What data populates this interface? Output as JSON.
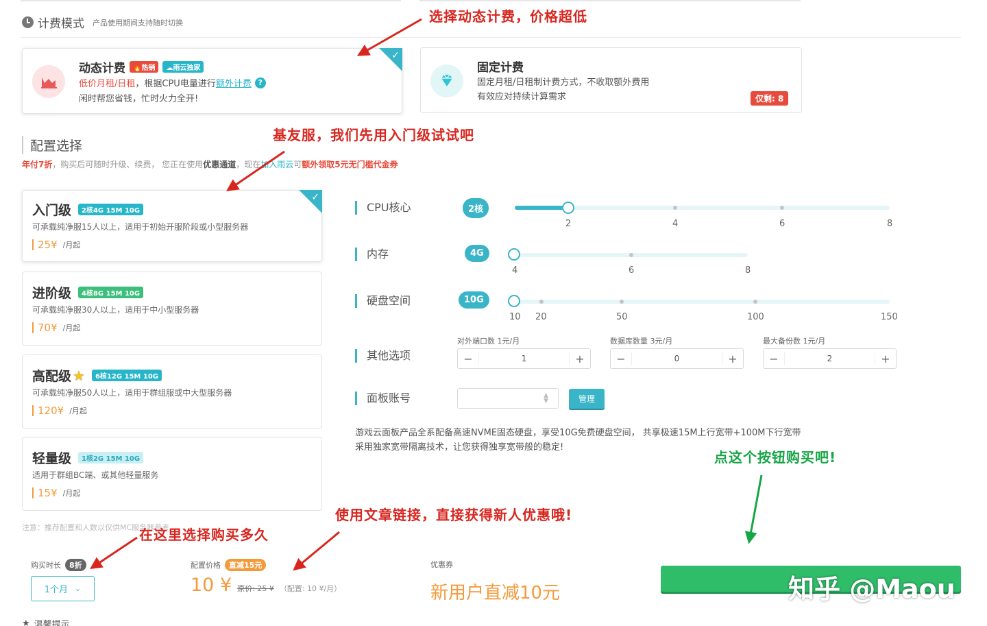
{
  "billing": {
    "section_title": "计费模式",
    "section_note": "产品使用期间支持随时切换",
    "dynamic": {
      "title": "动态计费",
      "tag_hot": "热销",
      "tag_exclusive": "雨云独家",
      "desc_line1_prefix": "低价月租/日租",
      "desc_line1_mid": "，根据CPU电量进行",
      "desc_line1_link": "额外计费",
      "desc_line2": "闲时帮您省钱，忙时火力全开!"
    },
    "fixed": {
      "title": "固定计费",
      "desc_line1": "固定月租/日租制计费方式，不收取额外费用",
      "desc_line2": "有效应对持续计算需求",
      "stock_badge": "仅剩: 8"
    }
  },
  "config": {
    "section_title": "配置选择",
    "promo_red": "年付7折",
    "promo_mid": "，购买后可随时升级、续费， 您正在使用",
    "promo_bold": "优惠通道",
    "promo_mid2": "，现在",
    "promo_link": "加入雨云",
    "promo_mid3": "可",
    "promo_red2": "额外领取5元无门槛代金券"
  },
  "plans": [
    {
      "title": "入门级",
      "spec": "2核4G 15M 10G",
      "desc": "可承载纯净服15人以上，适用于初始开服阶段或小型服务器",
      "price": "25¥",
      "unit": "/月起"
    },
    {
      "title": "进阶级",
      "spec": "4核8G 15M 10G",
      "desc": "可承载纯净服30人以上，适用于中小型服务器",
      "price": "70¥",
      "unit": "/月起"
    },
    {
      "title": "高配级",
      "spec": "6核12G 15M 10G",
      "desc": "可承载纯净服50人以上，适用于群组服或中大型服务器",
      "price": "120¥",
      "unit": "/月起"
    },
    {
      "title": "轻量级",
      "spec": "1核2G 15M 10G",
      "desc": "适用于群组BC端、或其他轻量服务",
      "price": "15¥",
      "unit": "/月起"
    }
  ],
  "plans_note": "注意：推荐配置和人数以仅供MC服务器参考",
  "sliders": {
    "cpu": {
      "label": "CPU核心",
      "value": "2核",
      "ticks": [
        "2",
        "4",
        "6",
        "8"
      ],
      "fill_fraction": 0.14
    },
    "mem": {
      "label": "内存",
      "value": "4G",
      "ticks": [
        "4",
        "6",
        "8"
      ]
    },
    "disk": {
      "label": "硬盘空间",
      "value": "10G",
      "ticks": [
        "10",
        "20",
        "50",
        "100",
        "150"
      ]
    }
  },
  "other": {
    "label": "其他选项",
    "ports": {
      "label": "对外端口数 1元/月",
      "value": "1"
    },
    "db": {
      "label": "数据库数量 3元/月",
      "value": "0"
    },
    "backup": {
      "label": "最大备份数 1元/月",
      "value": "2"
    }
  },
  "panel": {
    "label": "面板账号",
    "manage": "管理"
  },
  "footnote1": "游戏云面板产品全系配备高速NVME固态硬盘，享受10G免费硬盘空间， 共享极速15M上行宽带+100M下行宽带",
  "footnote2": "采用独家宽带隔离技术，让您获得独享宽带般的稳定!",
  "purchase": {
    "duration_label": "购买时长",
    "duration_badge": "8折",
    "duration_value": "1个月",
    "price_label": "配置价格",
    "price_badge": "直减15元",
    "price_value": "10 ¥",
    "price_original": "原价: 25 ¥",
    "price_config": "（配置: 10 ¥/月）",
    "coupon_label": "优惠券",
    "coupon_value": "新用户直减10元",
    "bottom_cut": "温馨提示"
  },
  "annotations": {
    "a1": "选择动态计费，价格超低",
    "a2": "基友服，我们先用入门级试试吧",
    "a3": "点这个按钮购买吧!",
    "a4": "使用文章链接，直接获得新人优惠哦!",
    "a5": "在这里选择购买多久"
  },
  "watermark": "知乎 @Maou",
  "colors": {
    "accent": "#3ab5c8",
    "price": "#f39a3b",
    "annotation": "#d8261f",
    "buy": "#2fbd6a"
  }
}
